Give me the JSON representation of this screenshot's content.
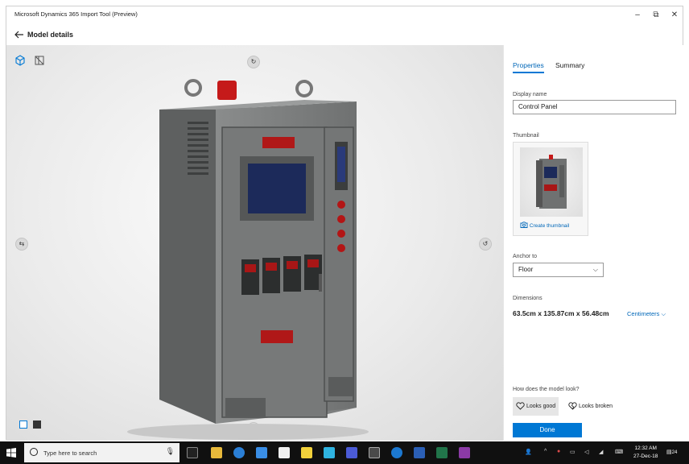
{
  "window": {
    "title": "Microsoft Dynamics 365 Import Tool (Preview)",
    "minimize": "–",
    "maximize": "⧉",
    "close": "✕"
  },
  "header": {
    "title": "Model details"
  },
  "panel": {
    "tabs": [
      {
        "label": "Properties",
        "active": true
      },
      {
        "label": "Summary",
        "active": false
      }
    ],
    "display_name_label": "Display name",
    "display_name_value": "Control Panel",
    "thumbnail_label": "Thumbnail",
    "create_thumbnail": "Create thumbnail",
    "anchor_label": "Anchor to",
    "anchor_value": "Floor",
    "dimensions_label": "Dimensions",
    "dimensions_value": "63.5cm x 135.87cm x 56.48cm",
    "units": "Centimeters",
    "feedback_question": "How does the model look?",
    "looks_good": "Looks good",
    "looks_broken": "Looks broken",
    "done": "Done"
  },
  "taskbar": {
    "search_placeholder": "Type here to search",
    "time": "12:32 AM",
    "date": "27-Dec-18",
    "notification_count": "24"
  },
  "colors": {
    "accent": "#0078d4",
    "link": "#0067b8",
    "taskbar": "#101010"
  }
}
